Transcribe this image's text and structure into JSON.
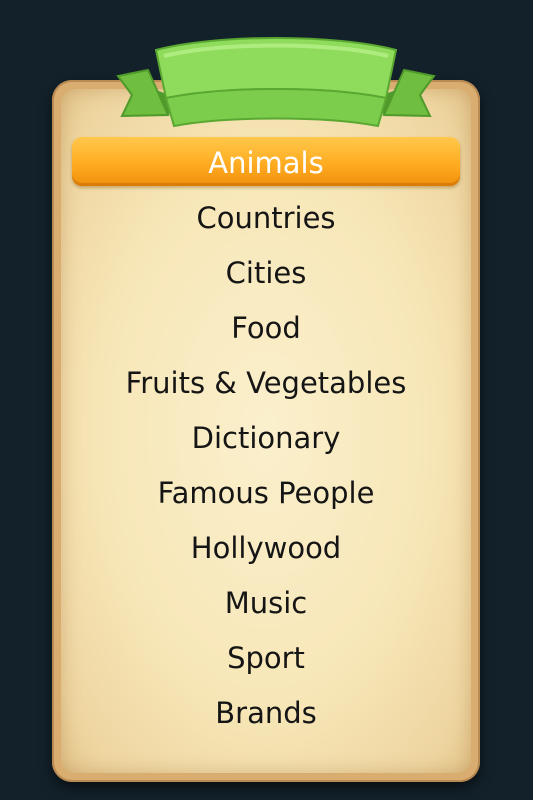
{
  "categories": [
    {
      "label": "Animals",
      "selected": true
    },
    {
      "label": "Countries",
      "selected": false
    },
    {
      "label": "Cities",
      "selected": false
    },
    {
      "label": "Food",
      "selected": false
    },
    {
      "label": "Fruits & Vegetables",
      "selected": false
    },
    {
      "label": "Dictionary",
      "selected": false
    },
    {
      "label": "Famous People",
      "selected": false
    },
    {
      "label": "Hollywood",
      "selected": false
    },
    {
      "label": "Music",
      "selected": false
    },
    {
      "label": "Sport",
      "selected": false
    },
    {
      "label": "Brands",
      "selected": false
    }
  ],
  "colors": {
    "background": "#13212a",
    "board_frame": "#d8ad6f",
    "parchment": "#f7e7b8",
    "ribbon": "#8fdc5c",
    "selected_highlight": "#ffac21"
  }
}
